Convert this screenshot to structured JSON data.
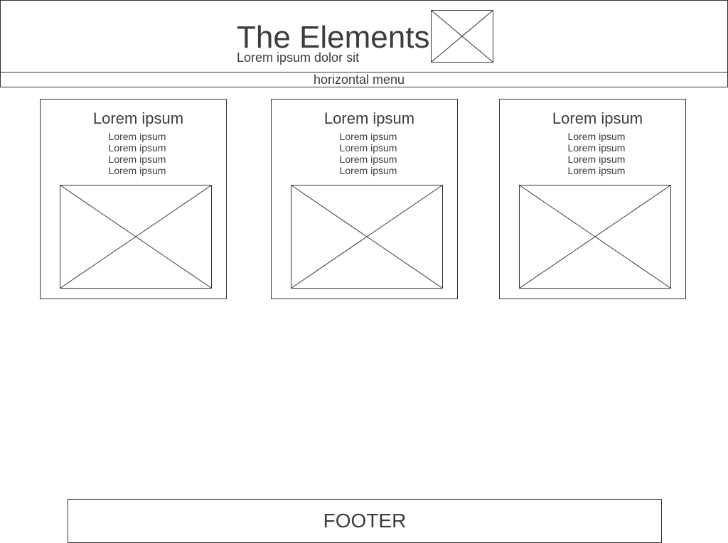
{
  "header": {
    "title": "The Elements",
    "subtitle": "Lorem ipsum dolor sit",
    "image_icon": "image-placeholder-icon"
  },
  "menu": {
    "label": "horizontal menu"
  },
  "cards": [
    {
      "title": "Lorem ipsum",
      "lines": [
        "Lorem ipsum",
        "Lorem ipsum",
        "Lorem ipsum",
        "Lorem ipsum"
      ],
      "image_icon": "image-placeholder-icon"
    },
    {
      "title": "Lorem ipsum",
      "lines": [
        "Lorem ipsum",
        "Lorem ipsum",
        "Lorem ipsum",
        "Lorem ipsum"
      ],
      "image_icon": "image-placeholder-icon"
    },
    {
      "title": "Lorem ipsum",
      "lines": [
        "Lorem ipsum",
        "Lorem ipsum",
        "Lorem ipsum",
        "Lorem ipsum"
      ],
      "image_icon": "image-placeholder-icon"
    }
  ],
  "footer": {
    "label": "FOOTER"
  },
  "colors": {
    "text": "#3c3c3c",
    "border": "#333333",
    "background": "#ffffff"
  }
}
